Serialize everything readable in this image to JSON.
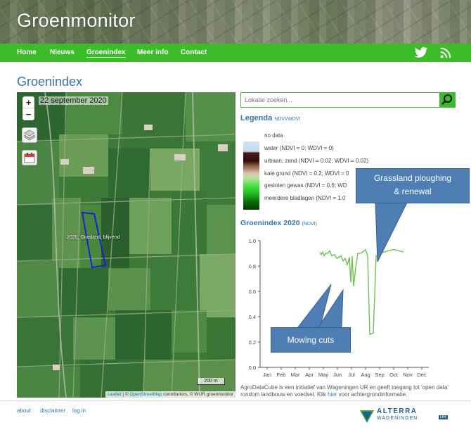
{
  "site": {
    "title": "Groenmonitor"
  },
  "nav": {
    "items": [
      {
        "label": "Home"
      },
      {
        "label": "Nieuws"
      },
      {
        "label": "Groenindex"
      },
      {
        "label": "Meer info"
      },
      {
        "label": "Contact"
      }
    ],
    "active": "Groenindex",
    "icons": [
      "twitter-icon",
      "rss-icon"
    ]
  },
  "page": {
    "title": "Groenindex"
  },
  "map": {
    "date": "22 september 2020",
    "zoom_in": "+",
    "zoom_out": "−",
    "parcel_label": "2020, Grasland, blijvend",
    "scale_label": "200 m",
    "attribution": {
      "leaflet": "Leaflet",
      "sep": " | © ",
      "osm": "OpenStreetMap",
      "rest": " contributors, © WUR groenmonitor"
    }
  },
  "search": {
    "placeholder": "Lokatie zoeken..."
  },
  "legend": {
    "title": "Legenda",
    "subtitle": "NDVI/WDVI",
    "rows": [
      "no data",
      "water (NDVI = 0; WDVI = 0)",
      "urbaan, zand (NDVI = 0.02; WDVI = 0.02)",
      "kale grond (NDVI = 0.2; WDVI = 0",
      "gesloten gewas (NDVI = 0.6; WD",
      "meerdere bladlagen (NDVI = 1.0"
    ]
  },
  "chart": {
    "title": "Groenindex 2020",
    "subtitle": "(NDVI)"
  },
  "chart_data": {
    "type": "line",
    "categories": [
      "Jan",
      "Feb",
      "Mar",
      "Apr",
      "May",
      "Jun",
      "Jul",
      "Aug",
      "Sep",
      "Oct",
      "Nov",
      "Dec"
    ],
    "ylim": [
      0.0,
      1.0
    ],
    "yticks": [
      "0.0",
      "0.2",
      "0.4",
      "0.6",
      "0.8",
      "1.0"
    ],
    "series": [
      {
        "color": "#6cc44f",
        "points": [
          [
            3.75,
            0.91
          ],
          [
            3.85,
            0.89
          ],
          [
            3.95,
            0.91
          ],
          [
            4.05,
            0.88
          ],
          [
            4.15,
            0.9
          ],
          [
            4.3,
            0.9
          ],
          [
            4.45,
            0.92
          ],
          [
            4.6,
            0.88
          ],
          [
            4.8,
            0.89
          ],
          [
            4.95,
            0.86
          ],
          [
            5.1,
            0.87
          ],
          [
            5.25,
            0.88
          ],
          [
            5.4,
            0.84
          ],
          [
            5.55,
            0.86
          ],
          [
            5.7,
            0.81
          ],
          [
            5.85,
            0.87
          ],
          [
            5.95,
            0.67
          ],
          [
            6.05,
            0.88
          ],
          [
            6.15,
            0.64
          ],
          [
            6.3,
            0.79
          ],
          [
            6.45,
            0.9
          ],
          [
            6.6,
            0.9
          ],
          [
            6.8,
            0.91
          ],
          [
            7.0,
            0.93
          ],
          [
            7.15,
            0.88
          ],
          [
            7.3,
            0.26
          ],
          [
            7.55,
            0.27
          ],
          [
            7.75,
            0.88
          ],
          [
            8.0,
            0.9
          ],
          [
            8.3,
            0.91
          ],
          [
            8.6,
            0.92
          ],
          [
            9.0,
            0.93
          ],
          [
            9.4,
            0.92
          ],
          [
            9.7,
            0.91
          ]
        ]
      }
    ]
  },
  "callouts": {
    "ploughing": "Grassland ploughing\n& renewal",
    "mowing": "Mowing cuts"
  },
  "footnote": {
    "text1": "AgroDataCube is een initiatief van Wageningen UR en geeft toegang tot 'open data' rondom landbouw en voedsel. Klik ",
    "link": "hier",
    "text2": " voor achtergrondinformatie."
  },
  "footer": {
    "links": [
      "about",
      "disclaimer",
      "log in"
    ],
    "logo": {
      "name": "ALTERRA",
      "sub": "WAGENINGEN",
      "ur": "UR"
    }
  }
}
